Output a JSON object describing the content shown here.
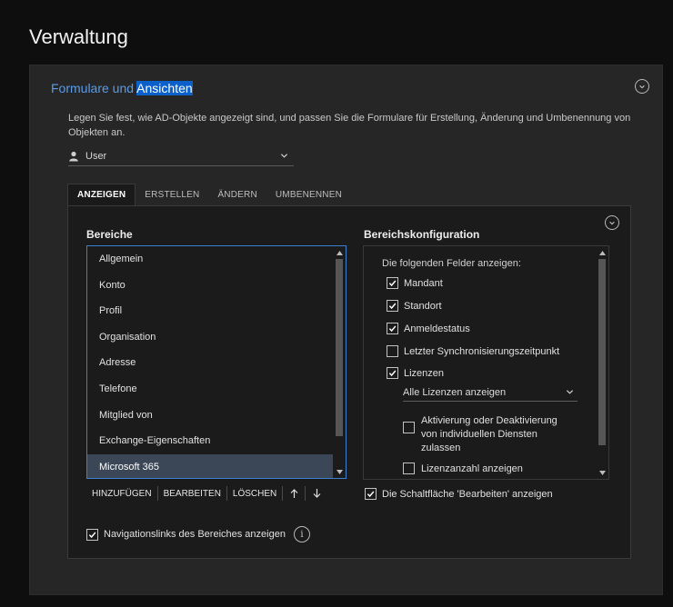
{
  "page": {
    "title": "Verwaltung"
  },
  "section": {
    "title_prefix": "Formulare und ",
    "title_highlight": "Ansichten",
    "description": "Legen Sie fest, wie AD-Objekte angezeigt sind, und passen Sie die Formulare für Erstellung, Änderung und Umbenennung von Objekten an.",
    "object_select": {
      "icon": "person-icon",
      "value": "User"
    }
  },
  "tabs": [
    {
      "label": "ANZEIGEN",
      "active": true
    },
    {
      "label": "ERSTELLEN",
      "active": false
    },
    {
      "label": "ÄNDERN",
      "active": false
    },
    {
      "label": "UMBENENNEN",
      "active": false
    }
  ],
  "areas": {
    "heading": "Bereiche",
    "items": [
      {
        "label": "Allgemein",
        "selected": false
      },
      {
        "label": "Konto",
        "selected": false
      },
      {
        "label": "Profil",
        "selected": false
      },
      {
        "label": "Organisation",
        "selected": false
      },
      {
        "label": "Adresse",
        "selected": false
      },
      {
        "label": "Telefone",
        "selected": false
      },
      {
        "label": "Mitglied von",
        "selected": false
      },
      {
        "label": "Exchange-Eigenschaften",
        "selected": false
      },
      {
        "label": "Microsoft 365",
        "selected": true
      }
    ],
    "toolbar": {
      "add": "HINZUFÜGEN",
      "edit": "BEARBEITEN",
      "delete": "LÖSCHEN",
      "move_up_icon": "arrow-up-icon",
      "move_down_icon": "arrow-down-icon"
    },
    "scroll": {
      "thumb_start": 0.0,
      "thumb_fraction": 0.86
    }
  },
  "config": {
    "heading": "Bereichskonfiguration",
    "caption": "Die folgenden Felder anzeigen:",
    "fields": [
      {
        "label": "Mandant",
        "checked": true
      },
      {
        "label": "Standort",
        "checked": true
      },
      {
        "label": "Anmeldestatus",
        "checked": true
      },
      {
        "label": "Letzter Synchronisierungszeitpunkt",
        "checked": false
      },
      {
        "label": "Lizenzen",
        "checked": true
      }
    ],
    "license_select": "Alle Lizenzen anzeigen",
    "toggle_services": {
      "label": "Aktivierung oder Deaktivierung von individuellen Diensten zulassen",
      "checked": false
    },
    "license_count": {
      "label": "Lizenzanzahl anzeigen",
      "checked": false
    },
    "scroll": {
      "thumb_start": 0.0,
      "thumb_fraction": 0.9
    }
  },
  "show_edit_button": {
    "label": "Die Schaltfläche 'Bearbeiten' anzeigen",
    "checked": true
  },
  "show_nav_links": {
    "label": "Navigationslinks des Bereiches anzeigen",
    "checked": true,
    "info_icon": "info-icon"
  },
  "colors": {
    "accent": "#5b9be6",
    "highlight": "#0c60c9",
    "selection": "#3b4656",
    "focus_border": "#3f7fd0"
  }
}
